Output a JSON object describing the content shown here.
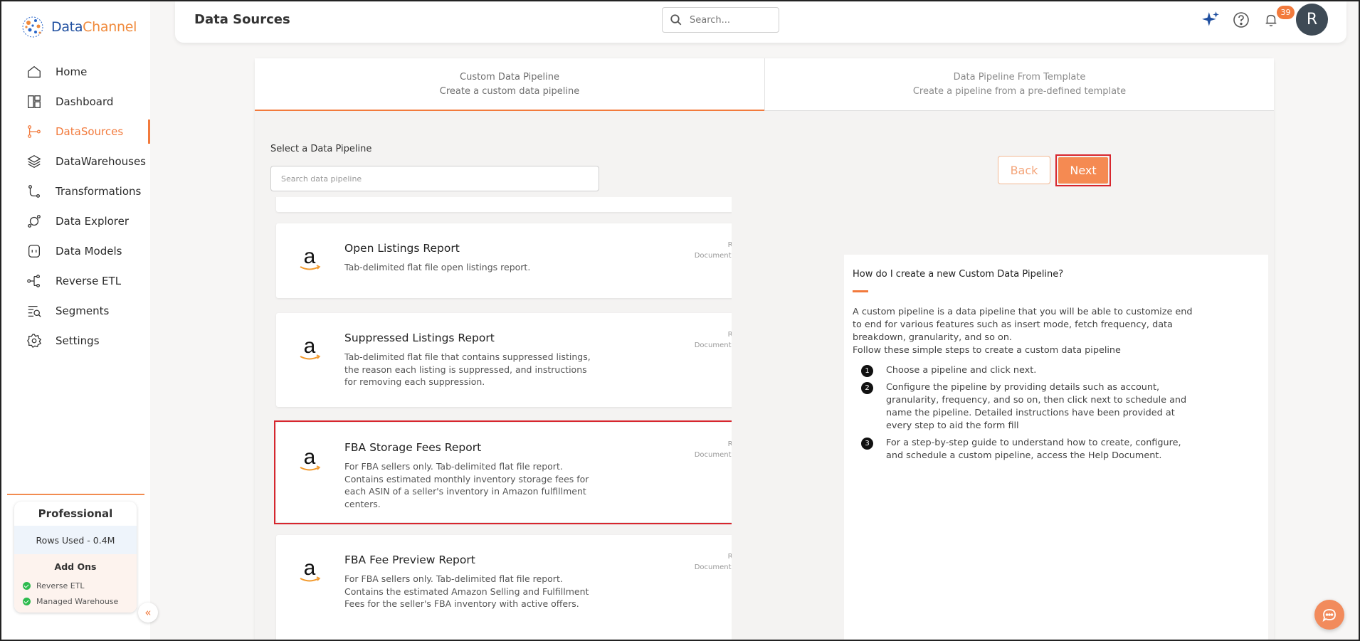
{
  "brand": {
    "name_part1": "Data",
    "name_part2": "Channel"
  },
  "sidebar": {
    "items": [
      {
        "label": "Home",
        "icon": "home-icon"
      },
      {
        "label": "Dashboard",
        "icon": "dashboard-icon"
      },
      {
        "label": "DataSources",
        "icon": "datasources-icon",
        "active": true
      },
      {
        "label": "DataWarehouses",
        "icon": "layers-icon"
      },
      {
        "label": "Transformations",
        "icon": "transform-icon"
      },
      {
        "label": "Data Explorer",
        "icon": "explorer-icon"
      },
      {
        "label": "Data Models",
        "icon": "models-icon"
      },
      {
        "label": "Reverse ETL",
        "icon": "reverse-etl-icon"
      },
      {
        "label": "Segments",
        "icon": "segments-icon"
      },
      {
        "label": "Settings",
        "icon": "gear-icon"
      }
    ],
    "plan": {
      "name": "Professional",
      "rows_used": "Rows Used - 0.4M",
      "addons_title": "Add Ons",
      "addons": [
        "Reverse ETL",
        "Managed Warehouse"
      ]
    }
  },
  "header": {
    "title": "Data Sources",
    "search_placeholder": "Search...",
    "notification_count": "39",
    "avatar_initial": "R"
  },
  "tabs": [
    {
      "title": "Custom Data Pipeline",
      "subtitle": "Create a custom data pipeline",
      "active": true
    },
    {
      "title": "Data Pipeline From Template",
      "subtitle": "Create a pipeline from a pre-defined template",
      "active": false
    }
  ],
  "selector": {
    "label": "Select a Data Pipeline",
    "search_placeholder": "Search data pipeline",
    "back_label": "Back",
    "next_label": "Next"
  },
  "pipelines": [
    {
      "title": "Open Listings Report",
      "description": "Tab-delimited flat file open listings report.",
      "link1": "Report Documentation",
      "link2": "Documentation Details (Source)",
      "selected": false
    },
    {
      "title": "Suppressed Listings Report",
      "description": "Tab-delimited flat file that contains suppressed listings, the reason each listing is suppressed, and instructions for removing each suppression.",
      "link1": "Report Documentation",
      "link2": "Documentation Details (Source)",
      "selected": false
    },
    {
      "title": "FBA Storage Fees Report",
      "description": "For FBA sellers only. Tab-delimited flat file report. Contains estimated monthly inventory storage fees for each ASIN of a seller's inventory in Amazon fulfillment centers.",
      "link1": "Report Documentation",
      "link2": "Documentation Details (Source)",
      "selected": true
    },
    {
      "title": "FBA Fee Preview Report",
      "description": "For FBA sellers only. Tab-delimited flat file report. Contains the estimated Amazon Selling and Fulfillment Fees for the seller's FBA inventory with active offers.",
      "link1": "Report Documentation",
      "link2": "Documentation Details (Source)",
      "selected": false
    }
  ],
  "help": {
    "title": "How do I create a new Custom Data Pipeline?",
    "intro": "A custom pipeline is a data pipeline that you will be able to customize end to end for various features such as insert mode, fetch frequency, data breakdown, granularity, and so on.",
    "intro2": "Follow these simple steps to create a custom data pipeline",
    "steps": [
      {
        "num": "1",
        "text": "Choose a pipeline and click next."
      },
      {
        "num": "2",
        "text": "Configure the pipeline by providing details such as account, granularity, frequency, and so on, then click next to schedule and name the pipeline. Detailed instructions have been provided at every step to aid the form fill"
      },
      {
        "num": "3",
        "text": "For a step-by-step guide to understand how to create, configure, and schedule a custom pipeline, access the Help Document."
      }
    ]
  },
  "colors": {
    "accent": "#f27a3c",
    "selection_outline": "#d7262e",
    "brand_blue": "#1f4fa0"
  }
}
